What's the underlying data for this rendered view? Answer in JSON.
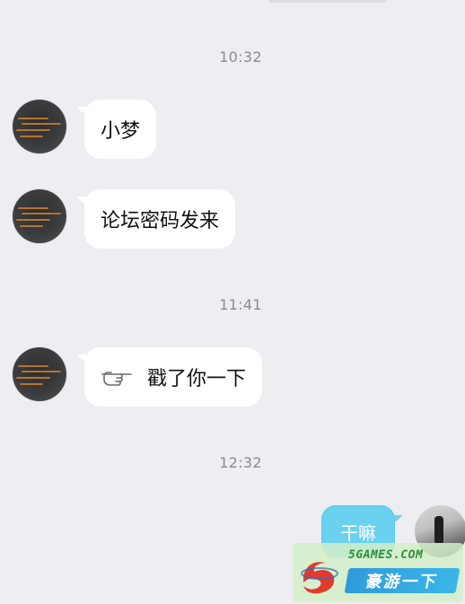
{
  "chat": {
    "timestamps": [
      "10:32",
      "11:41",
      "12:32"
    ],
    "messages": [
      {
        "sender": "contact",
        "text": "小梦"
      },
      {
        "sender": "contact",
        "text": "论坛密码发来"
      },
      {
        "sender": "contact",
        "type": "poke",
        "icon": "pointing-hand-icon",
        "text": "戳了你一下"
      },
      {
        "sender": "me",
        "text": "干嘛"
      }
    ]
  },
  "watermark": {
    "site_text": "5GAMES.COM",
    "brand_text": "豪游一下"
  },
  "colors": {
    "background": "#ededf2",
    "incoming_bubble": "#ffffff",
    "outgoing_bubble": "#6ad1ee",
    "timestamp": "#8a8a8f"
  }
}
